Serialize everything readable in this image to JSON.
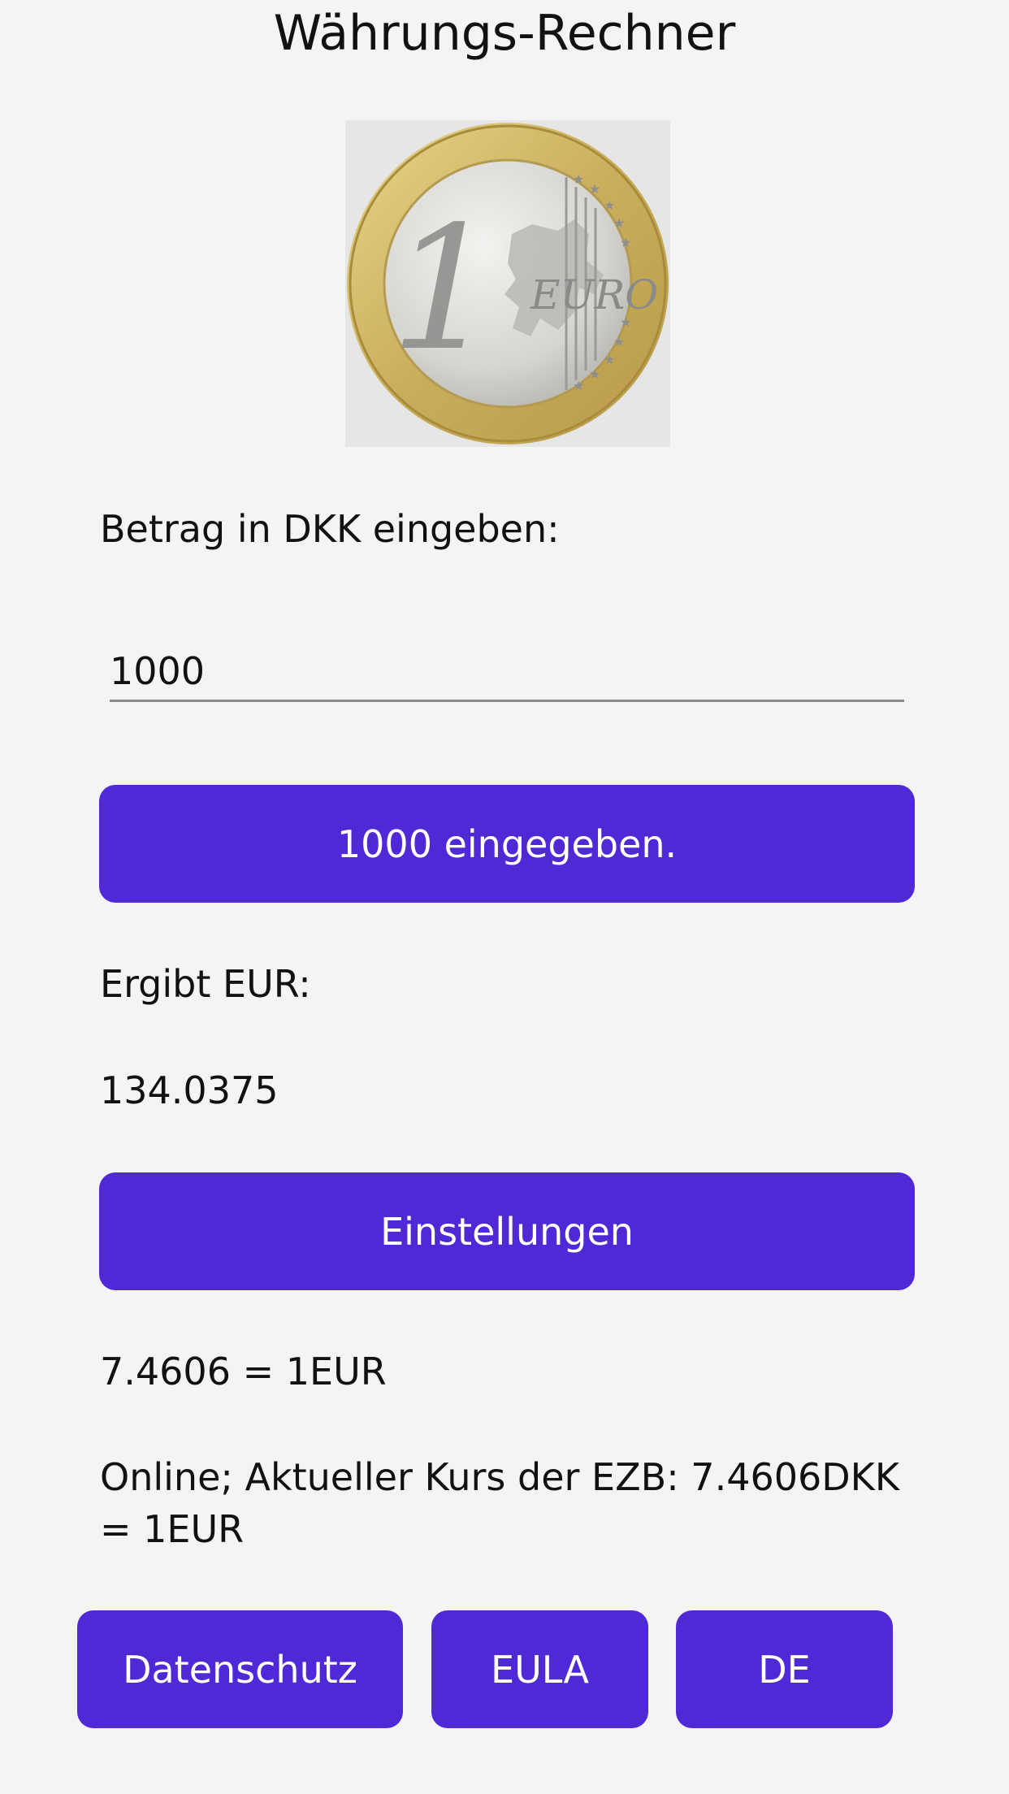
{
  "header": {
    "title": "Währungs-Rechner"
  },
  "coin": {
    "denomination": "1",
    "currency_word": "EURO",
    "icon": "euro-coin-icon"
  },
  "input": {
    "label": "Betrag in DKK eingeben:",
    "value": "1000"
  },
  "confirm_button": {
    "label": "1000 eingegeben."
  },
  "result": {
    "label": "Ergibt EUR:",
    "value": "134.0375"
  },
  "settings_button": {
    "label": "Einstellungen"
  },
  "rate": {
    "text": "7.4606 = 1EUR"
  },
  "online_status": {
    "text": "Online; Aktueller Kurs der EZB: 7.4606DKK = 1EUR"
  },
  "footer": {
    "privacy_label": "Datenschutz",
    "eula_label": "EULA",
    "language_label": "DE"
  },
  "colors": {
    "accent": "#5029d6",
    "background": "#f4f4f4",
    "text": "#111111"
  }
}
